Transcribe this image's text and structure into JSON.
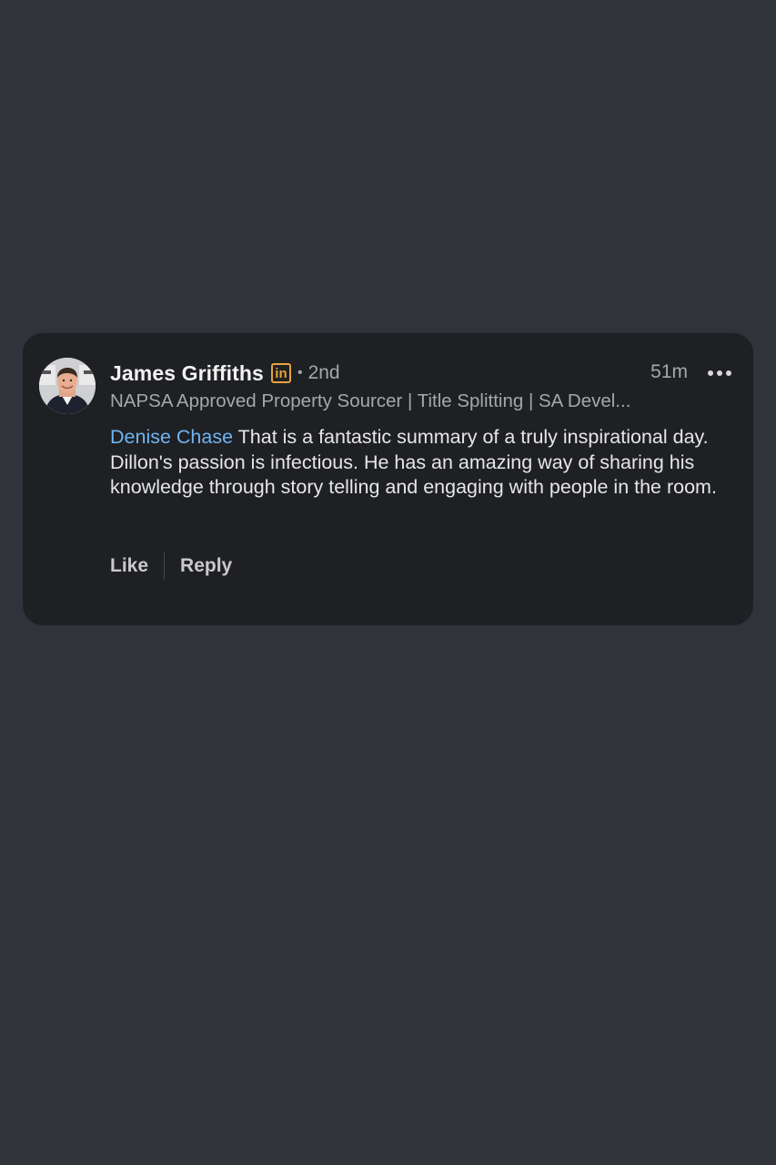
{
  "comment": {
    "author": {
      "name": "James Griffiths",
      "badge": "in",
      "separator": "•",
      "degree": "2nd",
      "headline": "NAPSA Approved Property Sourcer | Title Splitting | SA Devel..."
    },
    "time": "51m",
    "more_icon": "more-horizontal-icon",
    "mention": "Denise Chase",
    "body": "That is a fantastic summary of a truly inspirational day. Dillon's passion is infectious. He has an amazing way of sharing his knowledge through story telling and engaging with people in the room.",
    "actions": {
      "like": "Like",
      "reply": "Reply"
    }
  },
  "colors": {
    "background": "#31333b",
    "card": "#1e2024",
    "mention": "#71b4f0",
    "premium_badge": "#e7a33e",
    "primary_text": "#f2f2f2",
    "secondary_text": "#a6a7aa"
  }
}
